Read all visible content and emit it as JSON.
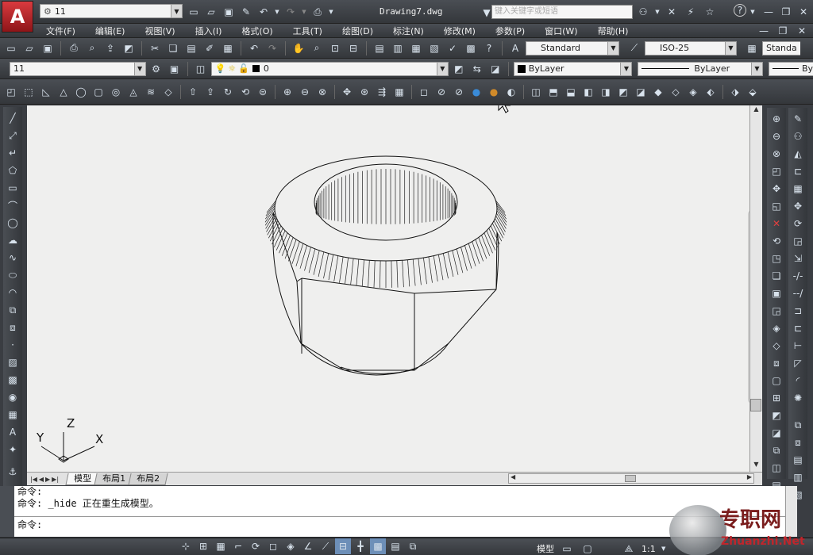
{
  "titlebar": {
    "app_menu_icon": "autocad-logo-icon",
    "workspace_value": "11",
    "doc_title": "Drawing7.dwg",
    "search_placeholder": "键入关键字或短语"
  },
  "menu": [
    "文件(F)",
    "编辑(E)",
    "视图(V)",
    "插入(I)",
    "格式(O)",
    "工具(T)",
    "绘图(D)",
    "标注(N)",
    "修改(M)",
    "参数(P)",
    "窗口(W)",
    "帮助(H)"
  ],
  "styles": {
    "text_style": "Standard",
    "dim_style": "ISO-25",
    "table_style": "Standa"
  },
  "layers": {
    "workspace": "11",
    "layer_name": "0",
    "color": "ByLayer",
    "linetype": "ByLayer",
    "lineweight": "By"
  },
  "tabs": [
    "模型",
    "布局1",
    "布局2"
  ],
  "ucs": {
    "x": "X",
    "y": "Y",
    "z": "Z"
  },
  "command": {
    "line1": "命令:",
    "line2": "命令: _hide 正在重生成模型。",
    "prompt": "命令:"
  },
  "status": {
    "model_label": "模型",
    "scale": "1:1"
  },
  "watermark": {
    "cn": "专职网",
    "en": "Zhuanzhi.Net"
  },
  "colors": {
    "accent": "#c0262c",
    "layer_swatch": "#000000"
  }
}
